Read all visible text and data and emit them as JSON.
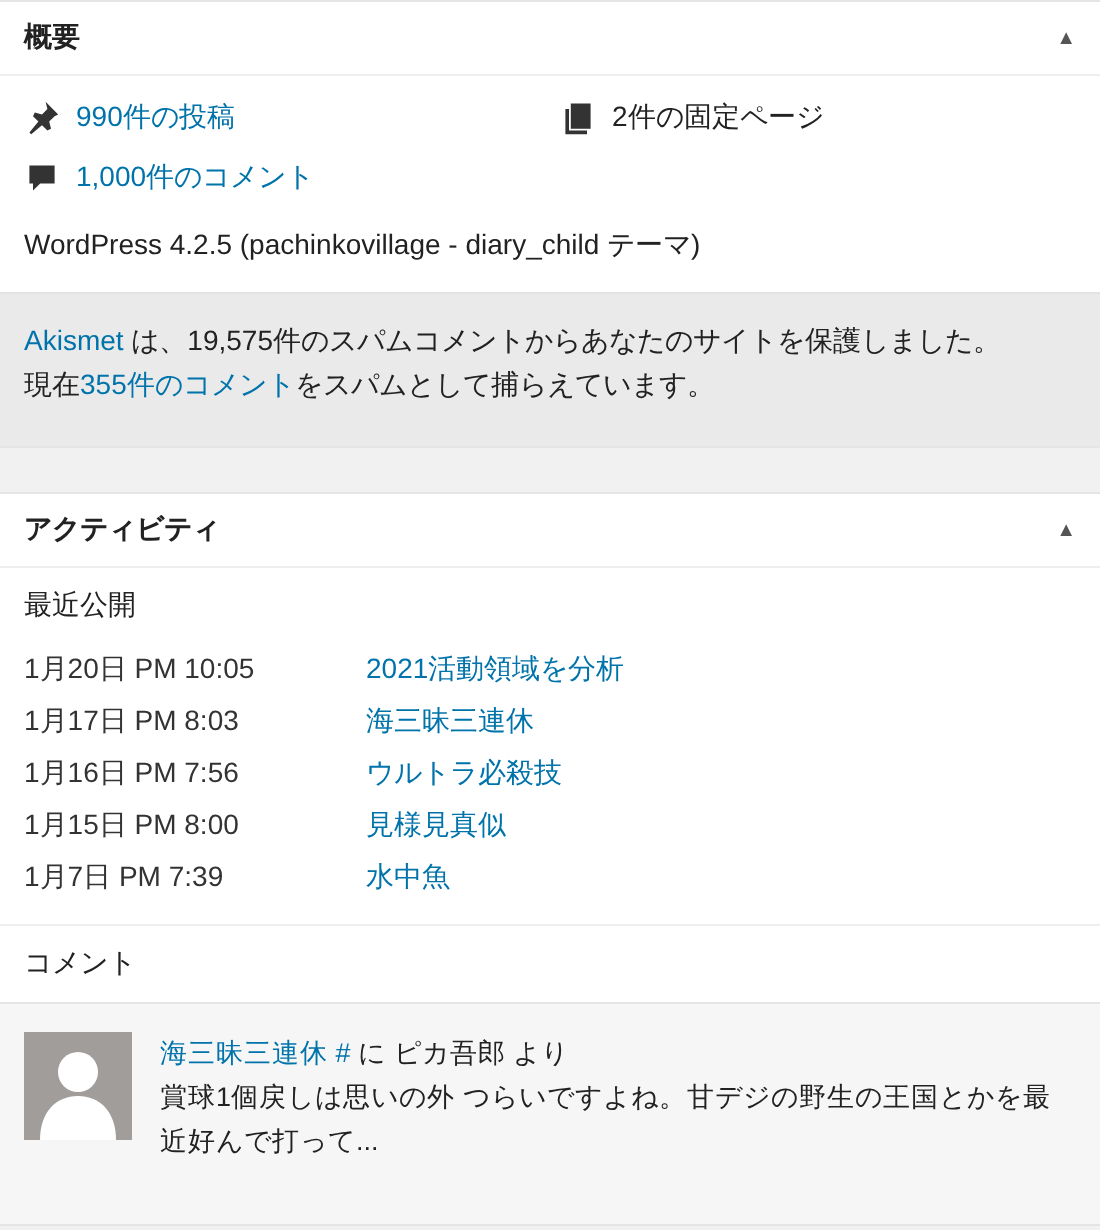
{
  "overview": {
    "title": "概要",
    "collapse_icon": "▲",
    "glance": [
      {
        "kind": "posts",
        "label": "990件の投稿",
        "link": true
      },
      {
        "kind": "pages",
        "label": "2件の固定ページ",
        "link": false
      },
      {
        "kind": "comments",
        "label": "1,000件のコメント",
        "link": true
      }
    ],
    "version": "WordPress 4.2.5 (pachinkovillage - diary_child テーマ)",
    "akismet": [
      [
        {
          "text": "Akismet",
          "link": true
        },
        {
          "text": " は、19,575件のスパムコメントからあなたのサイトを保護しました。",
          "link": false
        }
      ],
      [
        {
          "text": "現在",
          "link": false
        },
        {
          "text": "355件のコメント",
          "link": true
        },
        {
          "text": "をスパムとして捕らえています。",
          "link": false
        }
      ]
    ]
  },
  "activity": {
    "title": "アクティビティ",
    "collapse_icon": "▲",
    "recent_heading": "最近公開",
    "recent": [
      {
        "date": "1月20日 PM 10:05",
        "title": "2021活動領域を分析"
      },
      {
        "date": "1月17日 PM 8:03",
        "title": "海三昧三連休"
      },
      {
        "date": "1月16日 PM 7:56",
        "title": "ウルトラ必殺技"
      },
      {
        "date": "1月15日 PM 8:00",
        "title": "見様見真似"
      },
      {
        "date": "1月7日 PM 7:39",
        "title": "水中魚"
      }
    ],
    "comments_heading": "コメント",
    "comments": [
      {
        "post": "海三昧三連休",
        "hash": "#",
        "by": "に ピカ吾郎 より",
        "excerpt": "賞球1個戻しは思いの外 つらいですよね。甘デジの野生の王国とかを最近好んで打って..."
      }
    ]
  }
}
